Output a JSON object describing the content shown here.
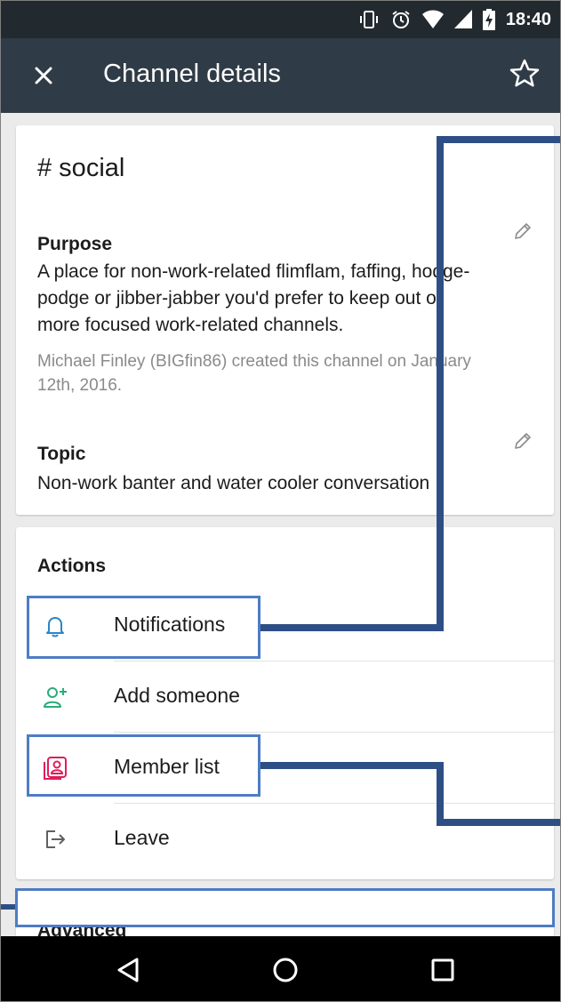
{
  "status_bar": {
    "time": "18:40",
    "icons": [
      "vibrate-icon",
      "alarm-icon",
      "wifi-icon",
      "signal-icon",
      "battery-charging-icon"
    ]
  },
  "app_bar": {
    "title": "Channel details",
    "close_icon": "close-icon",
    "star_icon": "star-outline-icon"
  },
  "channel": {
    "name": "# social",
    "purpose": {
      "label": "Purpose",
      "text_line1": "A place for non-work-related flimflam, faffing, hodge-",
      "text_line2": "podge or jibber-jabber you'd prefer to keep out of",
      "text_line3": "more focused work-related channels.",
      "meta_line1": "Michael Finley (BIGfin86) created this channel on January",
      "meta_line2": "12th, 2016."
    },
    "topic": {
      "label": "Topic",
      "text": "Non-work banter and water cooler conversation"
    }
  },
  "actions": {
    "label": "Actions",
    "items": [
      {
        "label": "Notifications",
        "icon": "bell-icon",
        "color": "#2d86c8"
      },
      {
        "label": "Add someone",
        "icon": "add-person-icon",
        "color": "#2bac76"
      },
      {
        "label": "Member list",
        "icon": "member-list-icon",
        "color": "#e01e5a"
      },
      {
        "label": "Leave",
        "icon": "leave-icon",
        "color": "#616061"
      }
    ]
  },
  "advanced": {
    "label": "Advanced"
  },
  "colors": {
    "status_bar": "#22292f",
    "app_bar": "#2f3b46",
    "annotation_box": "#4f7cc4",
    "annotation_line": "#2e4f85"
  }
}
